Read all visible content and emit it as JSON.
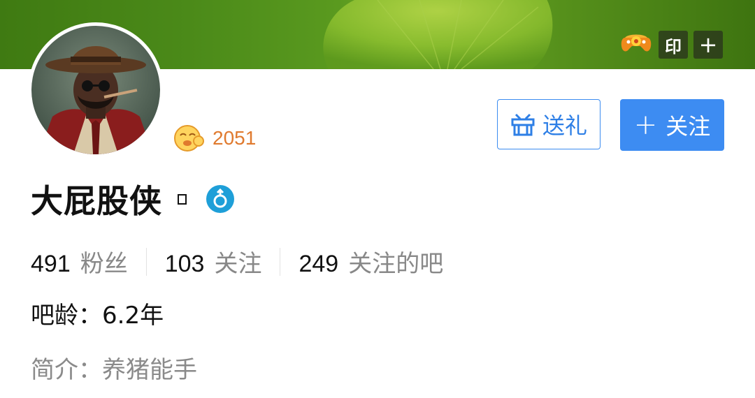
{
  "header": {
    "icons": [
      "game-controller-icon",
      "seal-icon",
      "plus-icon"
    ],
    "seal_label": "印",
    "plus_label": "+"
  },
  "profile": {
    "avatar_icon": "avatar-cowboy-portrait",
    "level_icon": "level-face-icon",
    "level_value": "2051",
    "username": "大屁股侠",
    "gender_icon": "male-gender-icon",
    "gift_label": "送礼",
    "follow_label": "关注"
  },
  "stats": [
    {
      "num": "491",
      "label": "粉丝"
    },
    {
      "num": "103",
      "label": "关注"
    },
    {
      "num": "249",
      "label": "关注的吧"
    }
  ],
  "age": {
    "label": "吧龄：",
    "value": "6.2年"
  },
  "bio": {
    "label": "简介：",
    "value": "养猪能手"
  },
  "colors": {
    "accent_blue": "#3d8cf2",
    "level_orange": "#e07a2e",
    "banner_green": "#4b8a19",
    "gender_teal": "#1e9fd8"
  }
}
